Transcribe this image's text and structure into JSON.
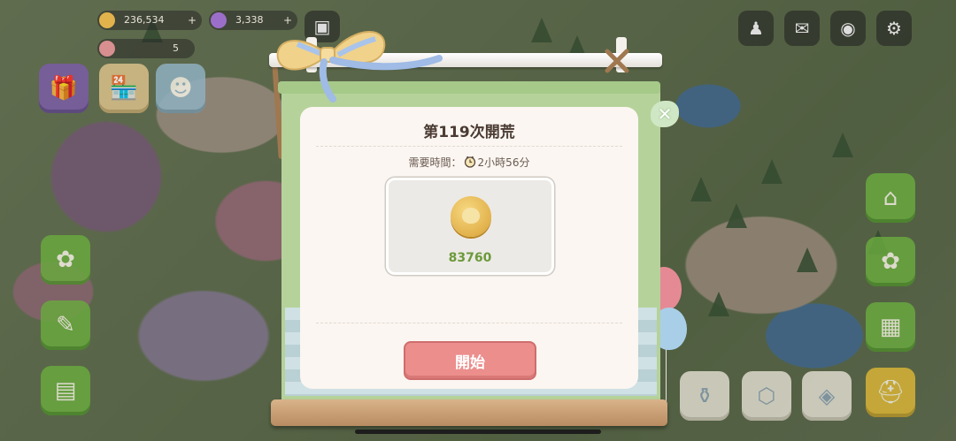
{
  "hud": {
    "coin_count": "236,534",
    "gem_count": "3,338",
    "energy_count": "5"
  },
  "dialog": {
    "title": "第119次開荒",
    "time_label": "需要時間：",
    "time_value": "2小時56分",
    "reward_amount": "83760",
    "start_label": "開始"
  },
  "icons": {
    "close": "close-icon",
    "clock": "clock-icon",
    "coin": "coin-icon"
  },
  "colors": {
    "start_button": "#eb8e8c",
    "reward_amount": "#6c9a3a",
    "board_green": "#b5d29a",
    "card_bg": "#fbf6f1"
  }
}
